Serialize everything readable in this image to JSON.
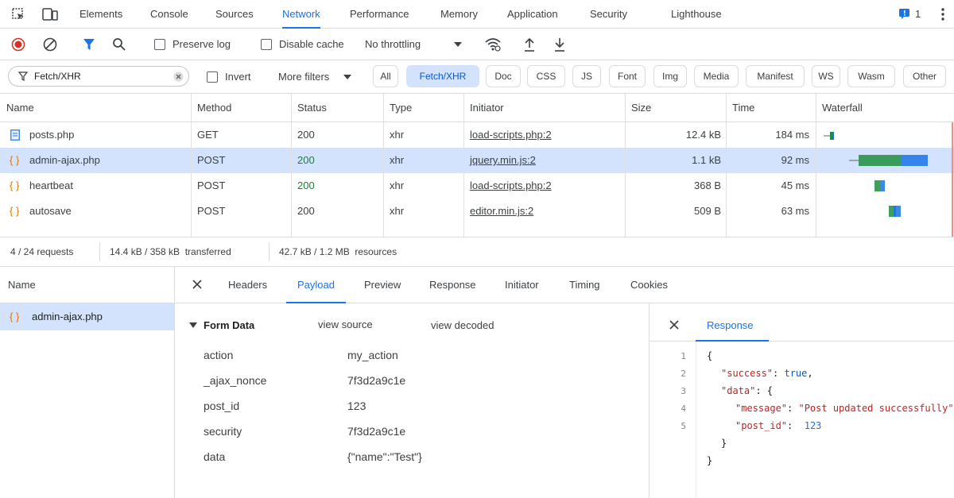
{
  "tabs": [
    "Elements",
    "Console",
    "Sources",
    "Network",
    "Performance",
    "Memory",
    "Application",
    "Security",
    "Lighthouse"
  ],
  "active_tab": "Network",
  "issues_count": "1",
  "toolbar": {
    "preserve_log": "Preserve log",
    "disable_cache": "Disable cache",
    "throttling": "No throttling"
  },
  "filter": {
    "value": "Fetch/XHR",
    "invert": "Invert",
    "more_filters": "More filters",
    "chips": [
      "All",
      "Fetch/XHR",
      "Doc",
      "CSS",
      "JS",
      "Font",
      "Img",
      "Media",
      "Manifest",
      "WS",
      "Wasm",
      "Other"
    ],
    "active_chip": "Fetch/XHR"
  },
  "table": {
    "headers": [
      "Name",
      "Method",
      "Status",
      "Type",
      "Initiator",
      "Size",
      "Time",
      "Waterfall"
    ],
    "rows": [
      {
        "name": "posts.php",
        "method": "GET",
        "status": "200",
        "type": "xhr",
        "initiator": "load-scripts.php:2",
        "size": "12.4 kB",
        "time": "184 ms"
      },
      {
        "name": "admin-ajax.php",
        "method": "POST",
        "status": "200",
        "type": "xhr",
        "initiator": "jquery.min.js:2",
        "size": "1.1 kB",
        "time": "92 ms"
      },
      {
        "name": "heartbeat",
        "method": "POST",
        "status": "200",
        "type": "xhr",
        "initiator": "load-scripts.php:2",
        "size": "368 B",
        "time": "45 ms"
      },
      {
        "name": "autosave",
        "method": "POST",
        "status": "200",
        "type": "xhr",
        "initiator": "editor.min.js:2",
        "size": "509 B",
        "time": "63 ms"
      }
    ]
  },
  "status": {
    "requests": "4 / 24 requests",
    "transferred": "14.4 kB / 358 kB  transferred",
    "resources": "42.7 kB / 1.2 MB  resources"
  },
  "bottom": {
    "name_header": "Name",
    "selected_name": "admin-ajax.php",
    "detail_tabs": [
      "Headers",
      "Payload",
      "Preview",
      "Response",
      "Initiator",
      "Timing",
      "Cookies"
    ],
    "active_detail_tab": "Payload",
    "form_data_title": "Form Data",
    "view_source": "view source",
    "view_decoded": "view decoded",
    "form_data": [
      {
        "key": "action",
        "value": "my_action"
      },
      {
        "key": "_ajax_nonce",
        "value": "7f3d2a9c1e"
      },
      {
        "key": "post_id",
        "value": "123"
      },
      {
        "key": "security",
        "value": "7f3d2a9c1e"
      },
      {
        "key": "data",
        "value": "{\"name\":\"Test\"}"
      }
    ],
    "response_tab": "Response",
    "response_lines": [
      "1",
      "2",
      "3",
      "4",
      "5"
    ],
    "response_code": {
      "l1": "{",
      "k_success": "\"success\"",
      "v_success": "true",
      "k_data": "\"data\"",
      "k_message": "\"message\"",
      "v_message": "\"Post updated successfully\"",
      "k_post_id": "\"post_id\"",
      "v_post_id": "123",
      "close_inner": "}",
      "close_outer": "}"
    }
  }
}
